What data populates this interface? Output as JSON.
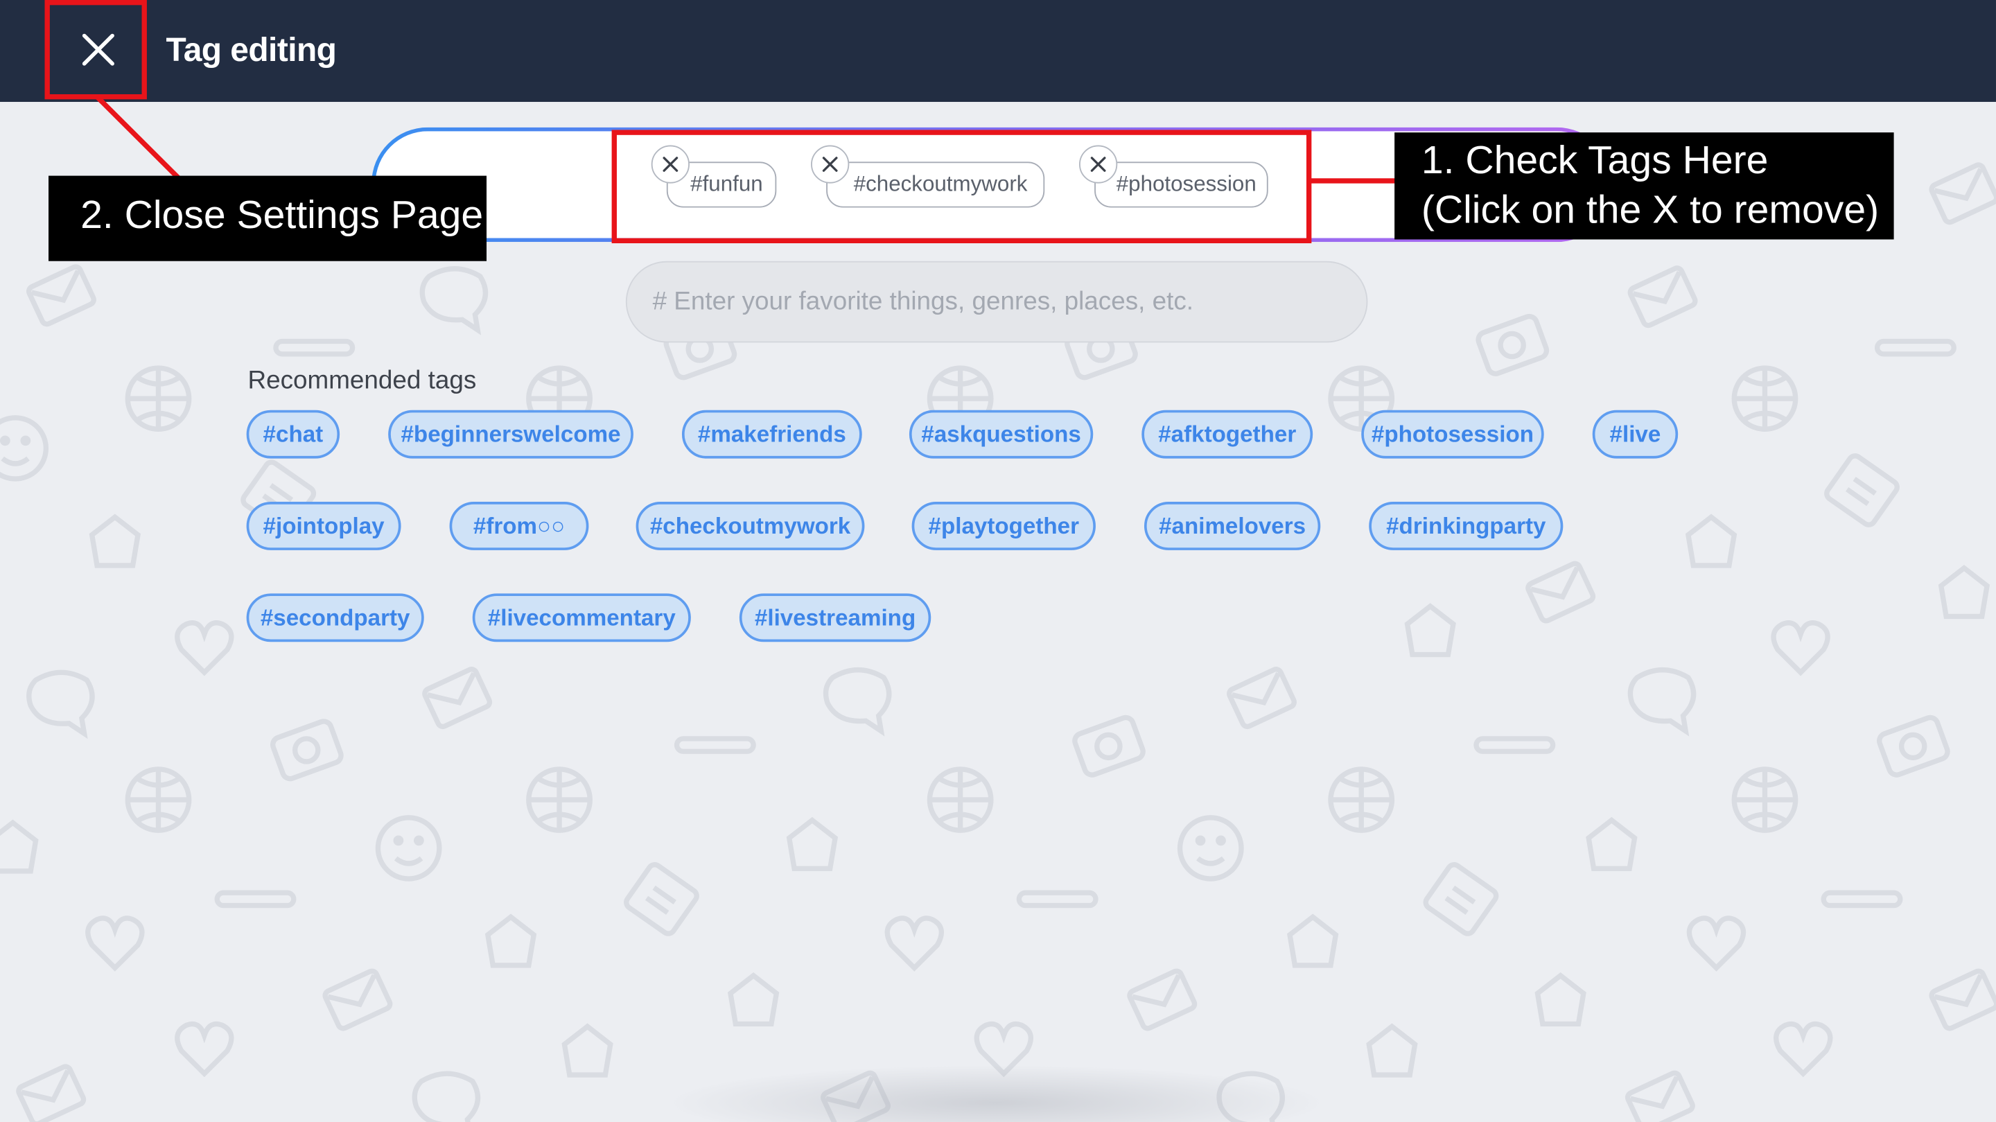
{
  "header": {
    "title": "Tag editing",
    "close_icon": "close-icon"
  },
  "selected_tags": [
    {
      "label": "#funfun"
    },
    {
      "label": "#checkoutmywork"
    },
    {
      "label": "#photosession"
    }
  ],
  "search": {
    "value": "",
    "placeholder": "# Enter your favorite things, genres, places, etc."
  },
  "recommended": {
    "title": "Recommended tags",
    "tags": [
      "#chat",
      "#beginnerswelcome",
      "#makefriends",
      "#askquestions",
      "#afktogether",
      "#photosession",
      "#live",
      "#jointoplay",
      "#from○○",
      "#checkoutmywork",
      "#playtogether",
      "#animelovers",
      "#drinkingparty",
      "#secondparty",
      "#livecommentary",
      "#livestreaming"
    ]
  },
  "annotations": {
    "check_tags_line1": "1.  Check Tags Here",
    "check_tags_line2": "(Click on the X to remove)",
    "close_settings": "2. Close Settings Page"
  },
  "colors": {
    "header_bg": "#222d42",
    "tag_text": "#3d85e8",
    "tag_fill": "#cfe2f7",
    "annotation_red": "#e8141a"
  }
}
